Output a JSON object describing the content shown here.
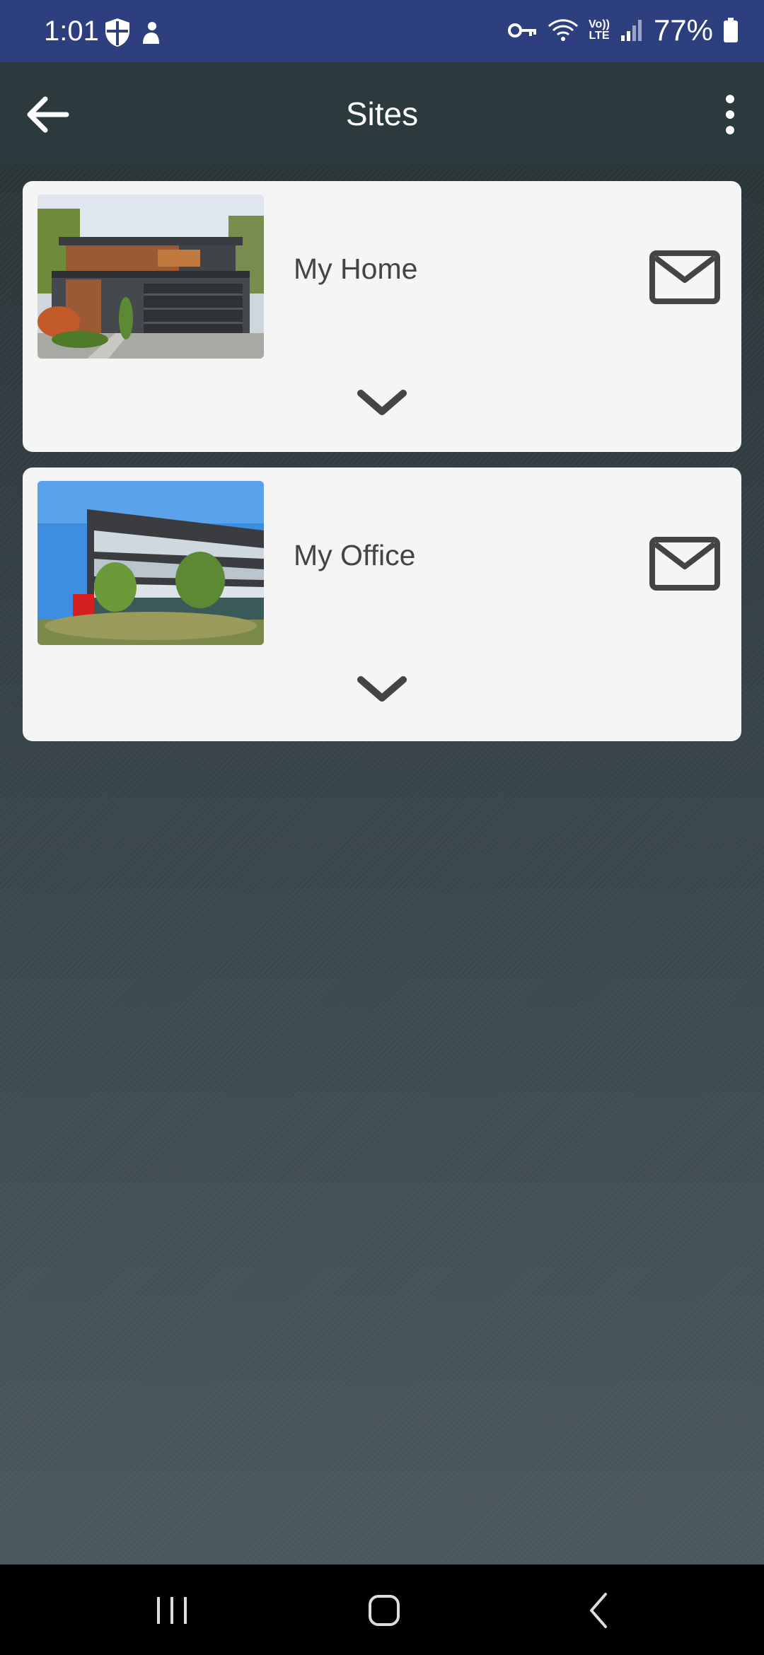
{
  "status_bar": {
    "time": "1:01",
    "battery": "77%",
    "network": "LTE",
    "icons": [
      "shield-icon",
      "person-icon",
      "vpn-key-icon",
      "wifi-icon",
      "volte-icon",
      "signal-icon",
      "battery-icon"
    ]
  },
  "app_bar": {
    "title": "Sites",
    "back_icon": "arrow-left-icon",
    "menu_icon": "more-vert-icon"
  },
  "sites": [
    {
      "name": "My Home",
      "image": "modern-house-photo",
      "mail_icon": "envelope-icon",
      "expand_icon": "chevron-down-icon"
    },
    {
      "name": "My Office",
      "image": "office-building-photo",
      "mail_icon": "envelope-icon",
      "expand_icon": "chevron-down-icon"
    }
  ],
  "nav_bar": {
    "icons": [
      "recent-apps-icon",
      "home-icon",
      "back-icon"
    ]
  },
  "colors": {
    "status_bar": "#2e3f7f",
    "app_bar": "#2c3a3e",
    "card": "#f5f5f5",
    "icon": "#444444"
  }
}
